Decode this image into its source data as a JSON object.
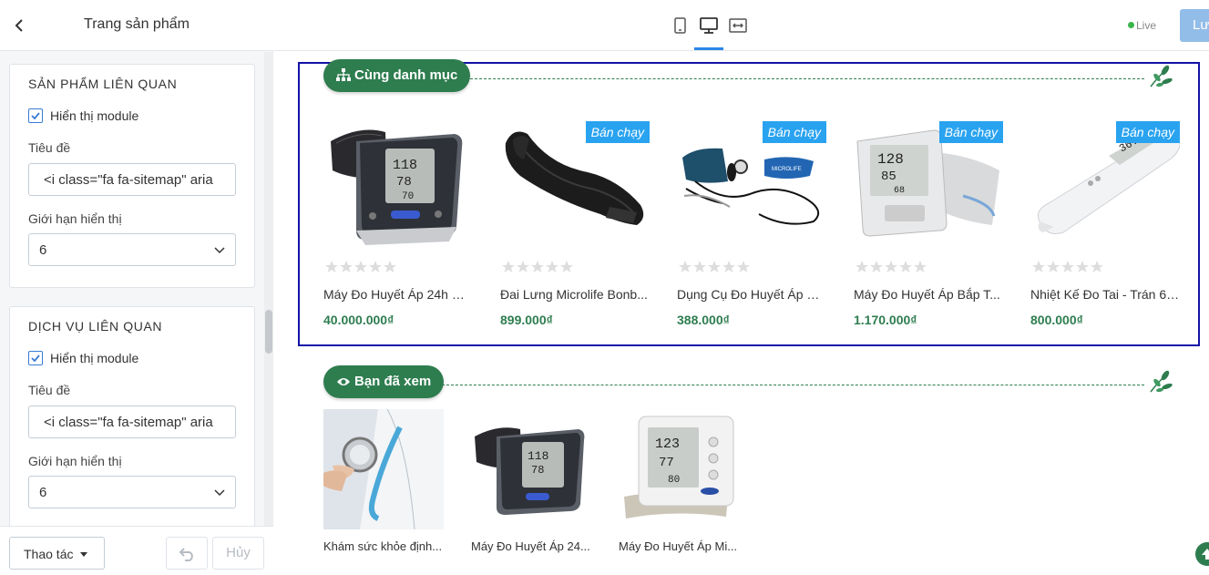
{
  "sidebar": {
    "title": "Trang sản phẩm",
    "related_products": {
      "heading": "SẢN PHẨM LIÊN QUAN",
      "show_module_label": "Hiển thị module",
      "title_label": "Tiêu đề",
      "title_value": "<i class=\"fa fa-sitemap\" aria",
      "limit_label": "Giới hạn hiển thị",
      "limit_value": "6"
    },
    "related_services": {
      "heading": "DỊCH VỤ LIÊN QUAN",
      "show_module_label": "Hiển thị module",
      "title_label": "Tiêu đề",
      "title_value": "<i class=\"fa fa-sitemap\" aria",
      "limit_label": "Giới hạn hiển thị",
      "limit_value": "6"
    },
    "footer": {
      "actions_label": "Thao tác",
      "cancel_label": "Hủy"
    }
  },
  "topbar": {
    "live_label": "Live",
    "save_label": "Lưu"
  },
  "preview": {
    "same_category": {
      "title": "Cùng danh mục",
      "products": [
        {
          "name": "Máy Đo Huyết Áp 24h W...",
          "price": "40.000.000₫",
          "tag": "",
          "image": "blood-pressure-monitor"
        },
        {
          "name": "Đai Lưng Microlife Bonb...",
          "price": "899.000₫",
          "tag": "Bán chạy",
          "image": "back-belt"
        },
        {
          "name": "Dụng Cụ Đo Huyết Áp M...",
          "price": "388.000₫",
          "tag": "Bán chạy",
          "image": "manual-sphygmomanometer"
        },
        {
          "name": "Máy Đo Huyết Áp Bắp T...",
          "price": "1.170.000₫",
          "tag": "Bán chạy",
          "image": "arm-bp-monitor"
        },
        {
          "name": "Nhiệt Kế Đo Tai - Trán 6 ...",
          "price": "800.000₫",
          "tag": "Bán chạy",
          "image": "ear-thermometer"
        }
      ]
    },
    "viewed": {
      "title": "Bạn đã xem",
      "items": [
        {
          "name": "Khám sức khỏe định...",
          "image": "doctor-stethoscope"
        },
        {
          "name": "Máy Đo Huyết Áp 24...",
          "image": "blood-pressure-monitor"
        },
        {
          "name": "Máy Đo Huyết Áp Mi...",
          "image": "wrist-bp-monitor"
        }
      ]
    }
  },
  "colors": {
    "brand_green": "#2e7d4f",
    "tag_blue": "#29a3f0",
    "selection_outline": "#1212a8",
    "save_button": "#93bde9"
  }
}
